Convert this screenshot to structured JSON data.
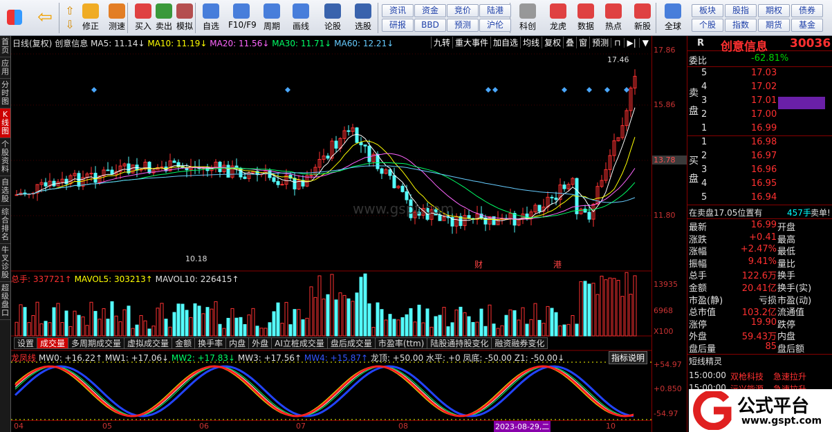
{
  "toolbar": {
    "items": [
      {
        "label": "修正",
        "icon": "up-down-arrow-icon"
      },
      {
        "label": "测速",
        "icon": "clock-icon"
      },
      {
        "label": "买入",
        "icon": "buy-icon"
      },
      {
        "label": "卖出",
        "icon": "sell-icon"
      },
      {
        "label": "模拟",
        "icon": "hammer-icon"
      },
      {
        "label": "自选",
        "icon": "star-icon"
      },
      {
        "label": "F10/F9",
        "icon": "f10-icon"
      },
      {
        "label": "周期",
        "icon": "period-icon"
      },
      {
        "label": "画线",
        "icon": "pencil-icon"
      },
      {
        "label": "论股",
        "icon": "comment-icon"
      },
      {
        "label": "选股",
        "icon": "select-stock-icon"
      },
      {
        "label": "科创",
        "icon": "kechuang-icon"
      },
      {
        "label": "龙虎",
        "icon": "dragon-icon"
      },
      {
        "label": "数据",
        "icon": "pe-icon"
      },
      {
        "label": "热点",
        "icon": "hot-icon"
      },
      {
        "label": "新股",
        "icon": "ipo-icon"
      },
      {
        "label": "全球",
        "icon": "globe-icon"
      }
    ],
    "small_buttons": [
      [
        "资讯",
        "研报"
      ],
      [
        "资金",
        "BBD"
      ],
      [
        "竞价",
        "预测"
      ],
      [
        "陆港",
        "沪伦"
      ]
    ],
    "right_buttons": [
      [
        "板块",
        "个股"
      ],
      [
        "股指",
        "指数"
      ],
      [
        "期权",
        "期货"
      ],
      [
        "债券",
        "基金"
      ]
    ]
  },
  "left_strip": [
    "首页",
    "应用",
    "分时图",
    "K线图",
    "个股资料",
    "自选股",
    "综合排名",
    "牛叉诊股",
    "超级盘口"
  ],
  "chart_header": {
    "period": "日线(复权)",
    "name": "创意信息",
    "ma5": "MA5: 11.14↓",
    "ma10": "MA10: 11.19↓",
    "ma20": "MA20: 11.56↓",
    "ma30": "MA30: 11.71↓",
    "ma60": "MA60: 12.21↓"
  },
  "chart_tools": [
    "九转",
    "重大事件",
    "加自选",
    "均线",
    "复权",
    "叠",
    "窗",
    "预测"
  ],
  "price_labels": {
    "high": "17.46",
    "low": "10.18",
    "marker1": "财",
    "marker2": "港",
    "watermark": "www.gspt.com"
  },
  "volume_header": {
    "total": "总手: 337721↑",
    "mavol5": "MAVOL5: 303213↑",
    "mavol10": "MAVOL10: 226415↑"
  },
  "indicator_tabs": [
    "设置",
    "成交量",
    "多周期成交量",
    "虚拟成交量",
    "金额",
    "换手率",
    "内盘",
    "外盘",
    "AI立桩成交量",
    "盘后成交量",
    "市盈率(ttm)",
    "陆股通持股变化",
    "融资融券变化"
  ],
  "indicator_header": {
    "name": "龙凤线",
    "mw0": "MW0: +16.22↑",
    "mw1": "MW1: +17.06↓",
    "mw2": "MW2: +17.83↓",
    "mw3": "MW3: +17.56↑",
    "mw4": "MW4: +15.87↑",
    "top": "龙顶: +50.00",
    "level": "水平: +0",
    "bottom": "凤底: -50.00",
    "z1": "Z1: -50.00↓",
    "help": "指标说明"
  },
  "axis": {
    "p1": "17.86",
    "p2": "15.86",
    "p3": "13.78",
    "p4": "11.80",
    "v1": "13935",
    "v2": "6968",
    "v3": "X100",
    "i1": "+54.97",
    "i2": "+0.850",
    "i3": "-54.97"
  },
  "xaxis": {
    "labels": [
      "04",
      "05",
      "06",
      "07",
      "08",
      "10"
    ],
    "date": "2023-08-29,二"
  },
  "quote": {
    "market": "R",
    "name": "创意信息",
    "code": "30036",
    "weibi_label": "委比",
    "weibi": "-62.81%",
    "sell": [
      [
        "5",
        "17.03"
      ],
      [
        "4",
        "17.02"
      ],
      [
        "3",
        "17.01"
      ],
      [
        "2",
        "17.00"
      ],
      [
        "1",
        "16.99"
      ]
    ],
    "buy": [
      [
        "1",
        "16.98"
      ],
      [
        "2",
        "16.97"
      ],
      [
        "3",
        "16.96"
      ],
      [
        "4",
        "16.95"
      ],
      [
        "5",
        "16.94"
      ]
    ],
    "sell_side": "卖盘",
    "buy_side": "买盘",
    "status": "在卖盘17.05位置有",
    "status_vol": "457手",
    "status_tag": "卖单!",
    "stats": [
      [
        "最新",
        "16.99",
        "开盘",
        ""
      ],
      [
        "涨跌",
        "+0.41",
        "最高",
        ""
      ],
      [
        "涨幅",
        "+2.47%",
        "最低",
        ""
      ],
      [
        "振幅",
        "9.41%",
        "量比",
        ""
      ],
      [
        "总手",
        "122.6万",
        "换手",
        ""
      ],
      [
        "金额",
        "20.41亿",
        "换手(实)",
        ""
      ],
      [
        "市盈(静)",
        "亏损",
        "市盈(动)",
        ""
      ],
      [
        "总市值",
        "103.2亿",
        "流通值",
        ""
      ],
      [
        "涨停",
        "19.90",
        "跌停",
        ""
      ],
      [
        "外盘",
        "59.43万",
        "内盘",
        ""
      ],
      [
        "盘后量",
        "85",
        "盘后额",
        ""
      ]
    ],
    "short_title": "短线精灵",
    "short": [
      [
        "15:00:00",
        "双枪科技",
        "急速拉升"
      ],
      [
        "15:00:00",
        "沅兴能源",
        "急速拉升"
      ]
    ]
  },
  "logo": {
    "text": "公式平台",
    "url": "www.gspt.com"
  }
}
